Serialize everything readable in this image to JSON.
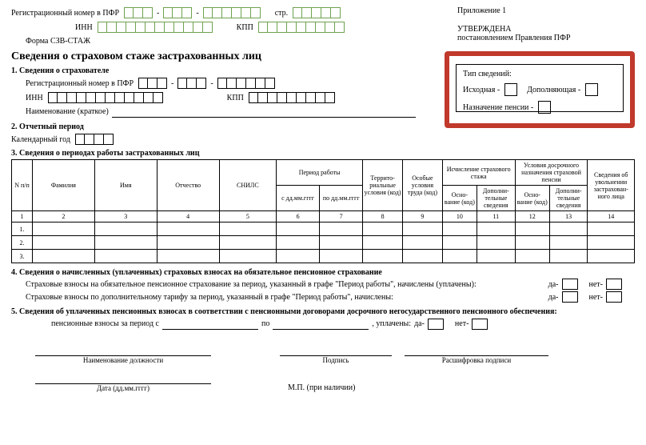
{
  "header": {
    "reg_label": "Регистрационный номер в ПФР",
    "page_label": "стр.",
    "inn_label": "ИНН",
    "kpp_label": "КПП",
    "form_code": "Форма СЗВ-СТАЖ",
    "appendix": "Приложение 1",
    "approved": "УТВЕРЖДЕНА",
    "approved_by": "постановлением Правления ПФР"
  },
  "title": "Сведения о страховом стаже застрахованных лиц",
  "typebox": {
    "heading": "Тип сведений:",
    "initial": "Исходная -",
    "supplement": "Дополняющая -",
    "pension": "Назначение пенсии -"
  },
  "sec1": {
    "heading": "1. Сведения о страхователе",
    "reg_label": "Регистрационный номер в ПФР",
    "inn_label": "ИНН",
    "kpp_label": "КПП",
    "name_label": "Наименование (краткое)"
  },
  "sec2": {
    "heading": "2. Отчетный период",
    "year_label": "Календарный год"
  },
  "sec3": {
    "heading": "3. Сведения о периодах работы застрахованных лиц",
    "cols": {
      "n": "N п/п",
      "surname": "Фамилия",
      "name": "Имя",
      "patronymic": "Отчество",
      "snils": "СНИЛС",
      "period": "Период работы",
      "from": "с дд.мм.гггг",
      "to": "по дд.мм.гггг",
      "terr": "Террито- риальные условия (код)",
      "special": "Особые условия труда (код)",
      "calc": "Исчисление страхового стажа",
      "early": "Условия досрочного назначения страховой пенсии",
      "base": "Осно- вание (код)",
      "extra": "Дополни- тельные сведения",
      "dismiss": "Сведения об увольнении застрахован- ного лица"
    },
    "nums": [
      "1",
      "2",
      "3",
      "4",
      "5",
      "6",
      "7",
      "8",
      "9",
      "10",
      "11",
      "12",
      "13",
      "14"
    ],
    "row_labels": [
      "1.",
      "2.",
      "3."
    ]
  },
  "sec4": {
    "heading": "4. Сведения о начисленных (уплаченных) страховых взносах на обязательное пенсионное страхование",
    "line1": "Страховые взносы на обязательное пенсионное страхование за период, указанный в графе \"Период работы\", начислены (уплачены):",
    "line2": "Страховые взносы по дополнительному тарифу за период, указанный в графе \"Период работы\", начислены:",
    "yes": "да-",
    "no": "нет-"
  },
  "sec5": {
    "heading": "5. Сведения об уплаченных пенсионных взносах в соответствии с пенсионными договорами досрочного негосударственного пенсионного обеспечения:",
    "contrib_label": "пенсионные взносы за период с",
    "to": "по",
    "paid": ", уплачены:",
    "yes": "да-",
    "no": "нет-"
  },
  "footer": {
    "position": "Наименование должности",
    "signature": "Подпись",
    "decipher": "Расшифровка подписи",
    "date": "Дата (дд.мм.гггг)",
    "stamp": "М.П. (при наличии)"
  }
}
